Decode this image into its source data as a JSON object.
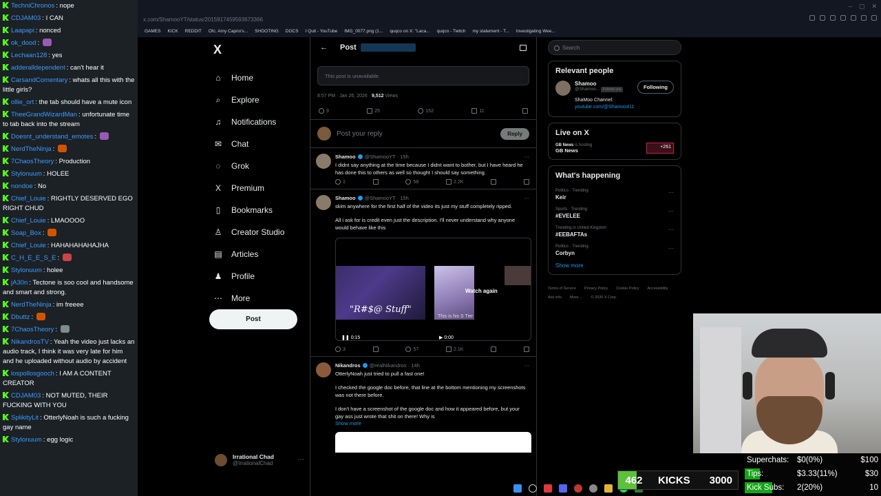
{
  "chat": [
    {
      "user": "TechniChronos",
      "msg": "nope"
    },
    {
      "user": "CDJAM03",
      "msg": "I CAN"
    },
    {
      "user": "Laapapi",
      "msg": "nonced"
    },
    {
      "user": "ok_dood",
      "msg": ""
    },
    {
      "user": "Lechaan128",
      "msg": "yes"
    },
    {
      "user": "adderalldependent",
      "msg": "can't hear it"
    },
    {
      "user": "CarsandComentary",
      "msg": "whats all this with the little girls?"
    },
    {
      "user": "ollie_ort",
      "msg": "the tab should have a mute icon"
    },
    {
      "user": "TheeGrandWizardMan",
      "msg": "unfortunate time to tab back into the stream"
    },
    {
      "user": "Doesnt_understand_emotes",
      "msg": ""
    },
    {
      "user": "NerdTheNinja",
      "msg": ""
    },
    {
      "user": "7ChaosTheory",
      "msg": "Production"
    },
    {
      "user": "Stylonuum",
      "msg": "HOLEE"
    },
    {
      "user": "nondoe",
      "msg": "No"
    },
    {
      "user": "Chief_Louie",
      "msg": "RIGHTLY DESERVED EGO RIGHT CHUD"
    },
    {
      "user": "Chief_Louie",
      "msg": "LMAOOOO"
    },
    {
      "user": "Soap_Box",
      "msg": ""
    },
    {
      "user": "Chief_Louie",
      "msg": "HAHAHAHAHAJHA"
    },
    {
      "user": "C_H_E_E_S_E",
      "msg": ""
    },
    {
      "user": "Stylonuum",
      "msg": "holee"
    },
    {
      "user": "jA30n",
      "msg": "Tectone is soo cool and handsome and smart and strong."
    },
    {
      "user": "NerdTheNinja",
      "msg": "im freeee"
    },
    {
      "user": "Dbuttz",
      "msg": ""
    },
    {
      "user": "7ChaosTheory",
      "msg": ""
    },
    {
      "user": "NikandrosTV",
      "msg": "Yeah the video just lacks an audio track, I think it was very late for him and he uploaded without audio by accident"
    },
    {
      "user": "lospollosgooch",
      "msg": "I AM A CONTENT CREATOR"
    },
    {
      "user": "CDJAM03",
      "msg": "NOT MUTED, THEIR FUCKING WITH YOU"
    },
    {
      "user": "SplikityLit",
      "msg": "OtterlyNoah is such a fucking gay name"
    },
    {
      "user": "Stylonuum",
      "msg": "egg logic"
    }
  ],
  "browser": {
    "url": "x.com/ShamooYT/status/2015917459593673366",
    "bookmarks": [
      "GAMES",
      "KICK",
      "REDDIT",
      "Ofc. Amy Caprio's...",
      "SHOOTING",
      "DOCS",
      "I Quit - YouTube",
      "IMG_0077.png (1...",
      "quqco on X: \"Laca...",
      "quqco - Twitch",
      "my statement - T...",
      "Investigating Wee..."
    ]
  },
  "xnav": {
    "logo": "X",
    "items": [
      {
        "label": "Home",
        "icon": "⌂"
      },
      {
        "label": "Explore",
        "icon": "⌕"
      },
      {
        "label": "Notifications",
        "icon": "♫"
      },
      {
        "label": "Chat",
        "icon": "✉"
      },
      {
        "label": "Grok",
        "icon": "◌"
      },
      {
        "label": "Premium",
        "icon": "X"
      },
      {
        "label": "Bookmarks",
        "icon": "▯"
      },
      {
        "label": "Creator Studio",
        "icon": "♙"
      },
      {
        "label": "Articles",
        "icon": "▤"
      },
      {
        "label": "Profile",
        "icon": "♟"
      },
      {
        "label": "More",
        "icon": "⋯"
      }
    ],
    "post_label": "Post",
    "account": {
      "name": "Irrational Chad",
      "handle": "@IrrationalChad"
    }
  },
  "main": {
    "title": "Post",
    "unavailable": "This post is unavailable.",
    "time": "8:57 PM · Jan 26, 2026 · ",
    "views_count": "9,512",
    "views_label": " Views",
    "stats": {
      "replies": "9",
      "reposts": "25",
      "likes": "152",
      "bookmarks": "11"
    },
    "reply_placeholder": "Post your reply",
    "reply_button": "Reply",
    "tweets": [
      {
        "name": "Shamoo",
        "handle": "@ShamooYT · 15h",
        "text": "I didnt say anything at the time because I didnt want to bother, but I have heard he has done this to others as well so thought I should say something.",
        "replies": "1",
        "reposts": "",
        "likes": "58",
        "views": "2.2K"
      },
      {
        "name": "Shamoo",
        "handle": "@ShamooYT · 15h",
        "text1": "skim anywhere for the first half of the video its just my stuff completely ripped.",
        "text2": "All i ask for is credit even just the description. I'll never understand why anyone would behave like this",
        "video_caption": "\"R#$@ Stuff\"",
        "video_watch_again": "Watch again",
        "video_sub": "This is his S    Tier",
        "video_time1": "0:15",
        "video_time2": "0:00",
        "replies": "3",
        "reposts": "",
        "likes": "57",
        "views": "2.1K"
      },
      {
        "name": "Nikandros",
        "handle": "@realNikandros · 14h",
        "text1": "OtterlyNoah just tried to pull a fast one!",
        "text2": "I checked the google doc before, that line at the bottom mentioning my screenshots was not there before.",
        "text3": "I don't have a screenshot of the google doc and how it appeared before, but your gay ass just wrote that shit on there! Why is",
        "show_more": "Show more"
      }
    ]
  },
  "right": {
    "search_placeholder": "Search",
    "relevant": {
      "title": "Relevant people",
      "name": "Shamoo",
      "handle": "@Shamoo...",
      "follows_you": "Follows you",
      "button": "Following",
      "bio": "ShaMoo Channel:",
      "link": "youtube.com/@Shamoo411"
    },
    "live": {
      "title": "Live on X",
      "host": "GB News",
      "hosting": "is hosting",
      "name": "GB News",
      "badge": "+261"
    },
    "happening": {
      "title": "What's happening",
      "trends": [
        {
          "cat": "Politics · Trending",
          "name": "Keir"
        },
        {
          "cat": "Sports · Trending",
          "name": "#EVELEE"
        },
        {
          "cat": "Trending in United Kingdom",
          "name": "#EEBAFTAs"
        },
        {
          "cat": "Politics · Trending",
          "name": "Corbyn"
        }
      ],
      "show_more": "Show more"
    },
    "footer": [
      "Terms of Service",
      "Privacy Policy",
      "Cookie Policy",
      "Accessibility",
      "Ads info",
      "More ...",
      "© 2026 X Corp."
    ]
  },
  "overlay": {
    "kicks_current": "462",
    "kicks_label": "KICKS",
    "kicks_goal": "3000",
    "kicks_progress": 0.154,
    "goals": [
      {
        "label": "Superchats:",
        "value": "$0(0%)",
        "target": "$100",
        "fraction": 0.0
      },
      {
        "label": "Tips:",
        "value": "$3.33(11%)",
        "target": "$30",
        "fraction": 0.11
      },
      {
        "label": "Kick Subs:",
        "value": "2(20%)",
        "target": "10",
        "fraction": 0.2
      }
    ]
  },
  "colors": {
    "accent": "#1d9bf0",
    "kick_green": "#53fc18",
    "goal_green": "#18a31a"
  }
}
